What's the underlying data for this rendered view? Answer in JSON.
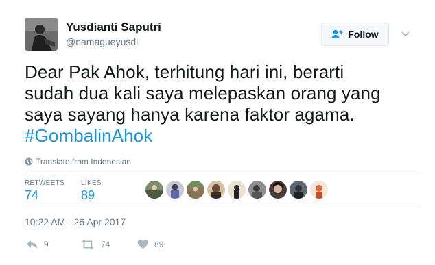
{
  "user": {
    "name": "Yusdianti Saputri",
    "handle": "@namagueyusdi"
  },
  "follow": {
    "label": "Follow"
  },
  "tweet": {
    "lines": [
      "Dear Pak Ahok, terhitung hari ini, berarti",
      "sudah dua kali saya melepaskan orang yang",
      "saya sayang hanya karena faktor agama."
    ],
    "hashtag": "#GombalinAhok"
  },
  "translate": {
    "label": "Translate from Indonesian",
    "icon": "globe-icon"
  },
  "stats": {
    "retweets_label": "RETWEETS",
    "retweets": "74",
    "likes_label": "LIKES",
    "likes": "89"
  },
  "likers_count": 9,
  "timestamp": "10:22 AM - 26 Apr 2017",
  "actions": {
    "reply_count": "9",
    "retweet_count": "74",
    "like_count": "89"
  },
  "colors": {
    "accent": "#1b95e0",
    "muted": "#657786",
    "icon_gray": "#8899a6"
  }
}
